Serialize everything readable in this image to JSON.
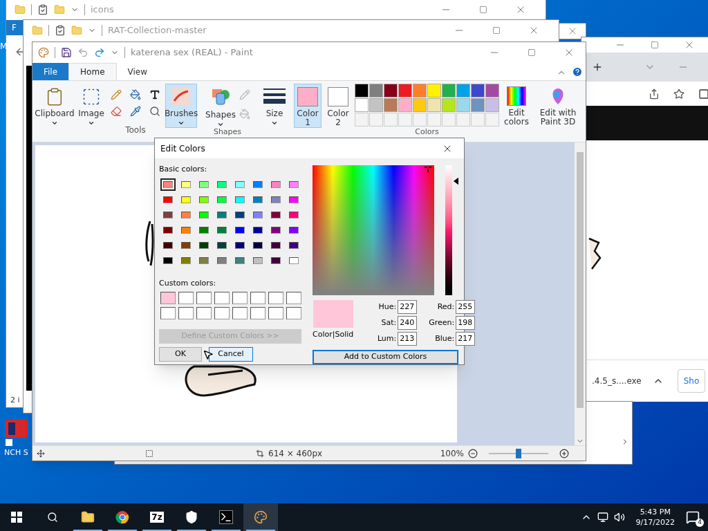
{
  "explorer_back": {
    "title": "icons",
    "ribbon_tab": "F",
    "side_letter": "M",
    "status": "2 i"
  },
  "explorer_front": {
    "title": "RAT-Collection-master"
  },
  "browser": {
    "download_file": ".4.5_s....exe",
    "side_button": "Sho"
  },
  "desktop_icon": {
    "label": "NCH S"
  },
  "paint": {
    "title": "katerena sex (REAL) - Paint",
    "tabs": [
      {
        "label": "File",
        "kind": "file",
        "selected": false
      },
      {
        "label": "Home",
        "kind": "tab",
        "selected": true
      },
      {
        "label": "View",
        "kind": "tab",
        "selected": false
      }
    ],
    "ribbon": {
      "clipboard": "Clipboard",
      "image": "Image",
      "tools": "Tools",
      "brushes": {
        "label": "Brushes",
        "selected": true
      },
      "shapes": "Shapes",
      "shapes_group": "Shapes",
      "size": "Size",
      "color1": {
        "label": "Color",
        "number": "1",
        "color": "#ffaec9",
        "selected": true
      },
      "color2": {
        "label": "Color",
        "number": "2",
        "color": "#ffffff",
        "selected": false
      },
      "palette": [
        {
          "color": "#000000"
        },
        {
          "color": "#7f7f7f"
        },
        {
          "color": "#880015"
        },
        {
          "color": "#ed1c24"
        },
        {
          "color": "#ff7f27"
        },
        {
          "color": "#fff200"
        },
        {
          "color": "#22b14c"
        },
        {
          "color": "#00a2e8"
        },
        {
          "color": "#3f48cc"
        },
        {
          "color": "#a349a4"
        },
        {
          "color": "#ffffff"
        },
        {
          "color": "#c3c3c3"
        },
        {
          "color": "#b97a57"
        },
        {
          "color": "#ffaec9"
        },
        {
          "color": "#ffc90e"
        },
        {
          "color": "#efe4b0"
        },
        {
          "color": "#b5e61d"
        },
        {
          "color": "#99d9ea"
        },
        {
          "color": "#7092be"
        },
        {
          "color": "#c8bfe7"
        }
      ],
      "colors_group": "Colors",
      "edit_colors": "Edit colors",
      "paint3d": "Edit with Paint 3D"
    },
    "status": {
      "size": "614 × 460px",
      "zoom": "100%",
      "level": 0.5
    }
  },
  "dialog": {
    "title": "Edit Colors",
    "basic_label": "Basic colors:",
    "basic": [
      {
        "color": "#ff8080",
        "selected": true
      },
      {
        "color": "#ffff80",
        "selected": false
      },
      {
        "color": "#80ff80",
        "selected": false
      },
      {
        "color": "#00ff80",
        "selected": false
      },
      {
        "color": "#80ffff",
        "selected": false
      },
      {
        "color": "#0080ff",
        "selected": false
      },
      {
        "color": "#ff80c0",
        "selected": false
      },
      {
        "color": "#ff80ff",
        "selected": false
      },
      {
        "color": "#ff0000",
        "selected": false
      },
      {
        "color": "#ffff00",
        "selected": false
      },
      {
        "color": "#80ff00",
        "selected": false
      },
      {
        "color": "#00ff40",
        "selected": false
      },
      {
        "color": "#00ffff",
        "selected": false
      },
      {
        "color": "#0080c0",
        "selected": false
      },
      {
        "color": "#8080c0",
        "selected": false
      },
      {
        "color": "#ff00ff",
        "selected": false
      },
      {
        "color": "#804040",
        "selected": false
      },
      {
        "color": "#ff8040",
        "selected": false
      },
      {
        "color": "#00ff00",
        "selected": false
      },
      {
        "color": "#008080",
        "selected": false
      },
      {
        "color": "#004080",
        "selected": false
      },
      {
        "color": "#8080ff",
        "selected": false
      },
      {
        "color": "#800040",
        "selected": false
      },
      {
        "color": "#ff0080",
        "selected": false
      },
      {
        "color": "#800000",
        "selected": false
      },
      {
        "color": "#ff8000",
        "selected": false
      },
      {
        "color": "#008000",
        "selected": false
      },
      {
        "color": "#008040",
        "selected": false
      },
      {
        "color": "#0000ff",
        "selected": false
      },
      {
        "color": "#0000a0",
        "selected": false
      },
      {
        "color": "#800080",
        "selected": false
      },
      {
        "color": "#8000ff",
        "selected": false
      },
      {
        "color": "#400000",
        "selected": false
      },
      {
        "color": "#804000",
        "selected": false
      },
      {
        "color": "#004000",
        "selected": false
      },
      {
        "color": "#004040",
        "selected": false
      },
      {
        "color": "#000080",
        "selected": false
      },
      {
        "color": "#000040",
        "selected": false
      },
      {
        "color": "#400040",
        "selected": false
      },
      {
        "color": "#400080",
        "selected": false
      },
      {
        "color": "#000000",
        "selected": false
      },
      {
        "color": "#808000",
        "selected": false
      },
      {
        "color": "#808040",
        "selected": false
      },
      {
        "color": "#808080",
        "selected": false
      },
      {
        "color": "#408080",
        "selected": false
      },
      {
        "color": "#c0c0c0",
        "selected": false
      },
      {
        "color": "#400040",
        "selected": false
      },
      {
        "color": "#ffffff",
        "selected": false
      }
    ],
    "custom_label": "Custom colors:",
    "custom": [
      {
        "color": "#ffc6d9"
      },
      {
        "color": "#ffffff"
      },
      {
        "color": "#ffffff"
      },
      {
        "color": "#ffffff"
      },
      {
        "color": "#ffffff"
      },
      {
        "color": "#ffffff"
      },
      {
        "color": "#ffffff"
      },
      {
        "color": "#ffffff"
      },
      {
        "color": "#ffffff"
      },
      {
        "color": "#ffffff"
      },
      {
        "color": "#ffffff"
      },
      {
        "color": "#ffffff"
      },
      {
        "color": "#ffffff"
      },
      {
        "color": "#ffffff"
      },
      {
        "color": "#ffffff"
      },
      {
        "color": "#ffffff"
      }
    ],
    "define_button": {
      "label": "Define Custom Colors >>",
      "disabled": true
    },
    "ok": "OK",
    "cancel": "Cancel",
    "preview": {
      "color": "#ffc6d9",
      "caption": "Color|Solid"
    },
    "fields": [
      {
        "label": "Hue:",
        "value": "227"
      },
      {
        "label": "Red:",
        "value": "255"
      },
      {
        "label": "Sat:",
        "value": "240"
      },
      {
        "label": "Green:",
        "value": "198"
      },
      {
        "label": "Lum:",
        "value": "213"
      },
      {
        "label": "Blue:",
        "value": "217"
      }
    ],
    "add_button": "Add to Custom Colors"
  },
  "taskbar": {
    "apps": [
      {
        "kind": "explorer",
        "selected": false
      },
      {
        "kind": "chrome",
        "selected": false
      },
      {
        "kind": "sevenzip",
        "label": "7z",
        "selected": false
      },
      {
        "kind": "shield",
        "selected": false
      },
      {
        "kind": "terminal",
        "selected": false
      },
      {
        "kind": "paint",
        "selected": true
      }
    ],
    "time": "5:43 PM",
    "date": "9/17/2022",
    "notifications": "4"
  }
}
